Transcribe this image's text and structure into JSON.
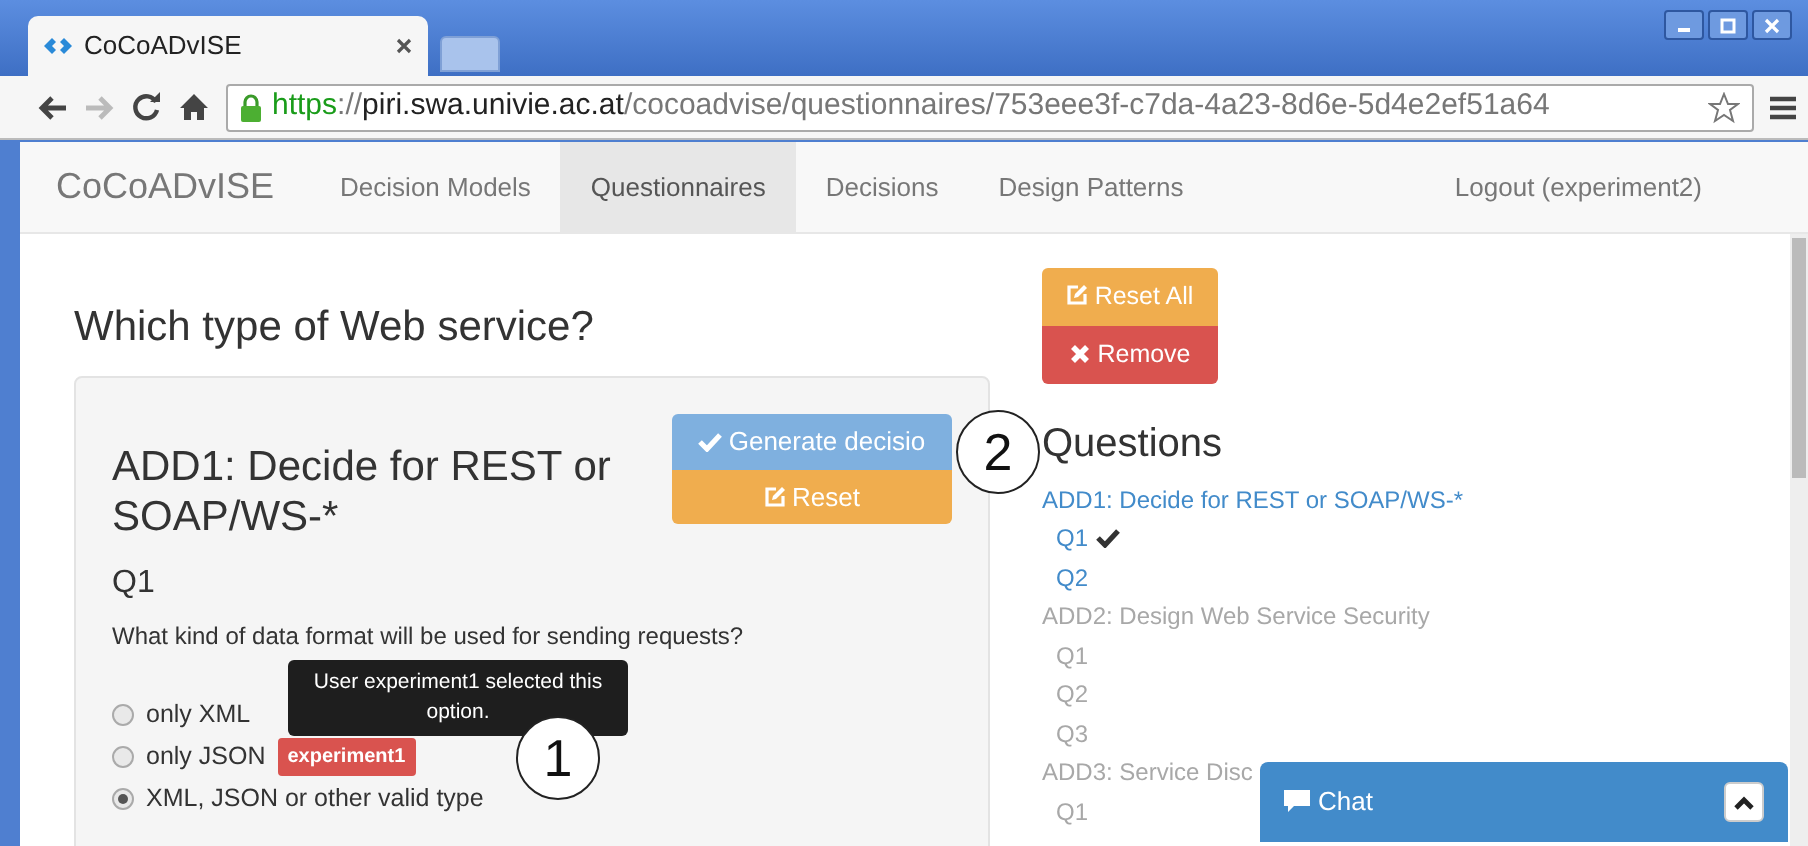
{
  "browser": {
    "tab": {
      "title": "CoCoADvISE"
    },
    "url": [
      {
        "text": "https",
        "kind": "secure"
      },
      {
        "text": "://",
        "kind": "plain"
      },
      {
        "text": "piri.swa.univie.ac.at",
        "kind": "host"
      },
      {
        "text": "/cocoadvise/questionnaires/753eee3f-c7da-4a23-8d6e-5d4e2ef51a64",
        "kind": "plain"
      }
    ]
  },
  "navbar": {
    "brand": "CoCoADvISE",
    "items": [
      {
        "label": "Decision Models",
        "selected": false
      },
      {
        "label": "Questionnaires",
        "selected": true
      },
      {
        "label": "Decisions",
        "selected": false
      },
      {
        "label": "Design Patterns",
        "selected": false
      }
    ],
    "logout": "Logout (experiment2)"
  },
  "page_title": "Which type of Web service?",
  "decision": {
    "title": "ADD1: Decide for REST or SOAP/WS-*",
    "buttons": [
      {
        "label": "Generate decisio",
        "kind": "primary"
      },
      {
        "label": "Reset",
        "kind": "warning"
      }
    ],
    "question": {
      "label": "Q1",
      "text": "What kind of data format will be used for sending requests?",
      "tooltip": "User experiment1 selected this option.",
      "options": [
        {
          "label": "only XML",
          "selected": false
        },
        {
          "label": "only JSON",
          "selected": false,
          "badge": "experiment1"
        },
        {
          "label": "XML, JSON or other valid type",
          "selected": true
        }
      ]
    }
  },
  "actions": [
    {
      "label": "Reset All",
      "kind": "warning"
    },
    {
      "label": "Remove",
      "kind": "danger"
    }
  ],
  "questions": {
    "title": "Questions",
    "items": [
      {
        "label": "ADD1: Decide for REST or SOAP/WS-*",
        "disabled": false,
        "children": [
          {
            "label": "Q1",
            "answered": true,
            "disabled": false
          },
          {
            "label": "Q2",
            "answered": false,
            "disabled": false
          }
        ]
      },
      {
        "label": "ADD2: Design Web Service Security",
        "disabled": true,
        "children": [
          {
            "label": "Q1",
            "answered": false,
            "disabled": true
          },
          {
            "label": "Q2",
            "answered": false,
            "disabled": true
          },
          {
            "label": "Q3",
            "answered": false,
            "disabled": true
          }
        ]
      },
      {
        "label": "ADD3: Service Disc",
        "disabled": true,
        "children": [
          {
            "label": "Q1",
            "answered": false,
            "disabled": true
          }
        ]
      }
    ]
  },
  "chat": {
    "title": "Chat"
  },
  "callouts": [
    "1",
    "2"
  ]
}
